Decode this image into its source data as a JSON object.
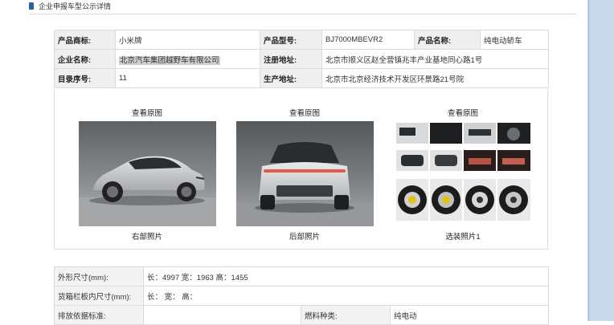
{
  "header": {
    "title": "企业申报车型公示详情"
  },
  "info": {
    "brand_label": "产品商标:",
    "brand_value": "小米牌",
    "model_label": "产品型号:",
    "model_value": "BJ7000MBEVR2",
    "name_label": "产品名称:",
    "name_value": "纯电动轿车",
    "company_label": "企业名称:",
    "company_value": "北京汽车集团越野车有限公司",
    "reg_addr_label": "注册地址:",
    "reg_addr_value": "北京市顺义区赵全营镇兆丰产业基地同心路1号",
    "catalog_label": "目录序号:",
    "catalog_value": "11",
    "prod_addr_label": "生产地址:",
    "prod_addr_value": "北京市北京经济技术开发区环景路21号院"
  },
  "photos": [
    {
      "top_caption": "查看原图",
      "bottom_caption": "右部照片"
    },
    {
      "top_caption": "查看原图",
      "bottom_caption": "后部照片"
    },
    {
      "top_caption": "查看原图",
      "bottom_caption": "选装照片1"
    }
  ],
  "dims": {
    "outer_label": "外形尺寸(mm):",
    "outer_value": "长：4997 宽：1963 高：1455",
    "cargo_label": "货箱栏板内尺寸(mm):",
    "cargo_value": "长：  宽：  高：",
    "emission_label": "排放依据标准:",
    "emission_value": "",
    "fuel_label": "燃料种类:",
    "fuel_value": "纯电动"
  },
  "colors": {
    "label_bg": "#efefef",
    "border": "#dcdcdc",
    "car_silver": "#c9cacc"
  }
}
